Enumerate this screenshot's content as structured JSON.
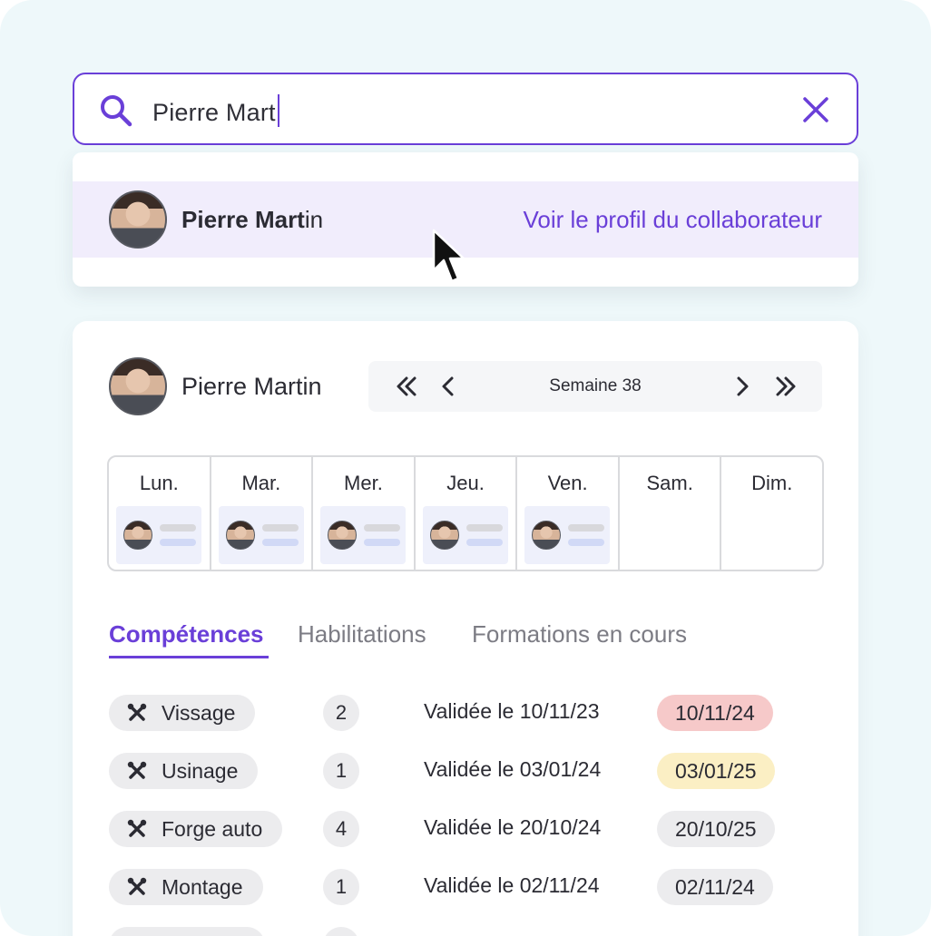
{
  "search": {
    "value": "Pierre Mart",
    "icon": "search-icon",
    "clear_icon": "close-icon",
    "accent": "#6a3fd8"
  },
  "dropdown": {
    "result": {
      "name_match": "Pierre Mart",
      "name_rest": "in",
      "link": "Voir le profil du collaborateur"
    }
  },
  "profile": {
    "name": "Pierre Martin",
    "week_label": "Semaine 38"
  },
  "week": {
    "days": [
      {
        "label": "Lun.",
        "shift": true
      },
      {
        "label": "Mar.",
        "shift": true
      },
      {
        "label": "Mer.",
        "shift": true
      },
      {
        "label": "Jeu.",
        "shift": true
      },
      {
        "label": "Ven.",
        "shift": true
      },
      {
        "label": "Sam.",
        "shift": false
      },
      {
        "label": "Dim.",
        "shift": false
      }
    ]
  },
  "tabs": [
    {
      "label": "Compétences",
      "active": true
    },
    {
      "label": "Habilitations",
      "active": false
    },
    {
      "label": "Formations en cours",
      "active": false
    }
  ],
  "skills": [
    {
      "name": "Vissage",
      "level": "2",
      "validated": "Validée le 10/11/23",
      "expiry": "10/11/24",
      "status_color": "#f6c9c9"
    },
    {
      "name": "Usinage",
      "level": "1",
      "validated": "Validée le 03/01/24",
      "expiry": "03/01/25",
      "status_color": "#fbefc4"
    },
    {
      "name": "Forge auto",
      "level": "4",
      "validated": "Validée le 20/10/24",
      "expiry": "20/10/25",
      "status_color": "#ececee"
    },
    {
      "name": "Montage",
      "level": "1",
      "validated": "Validée le 02/11/24",
      "expiry": "02/11/24",
      "status_color": "#ececee"
    }
  ]
}
